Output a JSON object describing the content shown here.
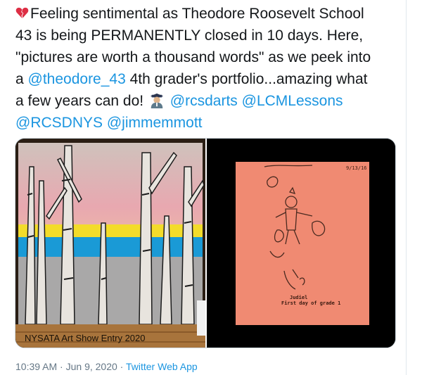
{
  "tweet": {
    "text_line1": "Feeling sentimental as Theodore Roosevelt School",
    "text_line2": "43 is being PERMANENTLY closed in 10 days. Here,",
    "text_line3": "\"pictures are worth a thousand words\" as we peek into",
    "text_line4_prefix": "a ",
    "mention_theodore": "@theodore_43",
    "text_line4_suffix": " 4th grader's portfolio...amazing what",
    "text_line5": "a few years can do!",
    "mention_rcsdarts": "@rcsdarts",
    "mention_lcmlessons": "@LCMLessons",
    "mention_rcsdnys": "@RCSDNYS",
    "mention_jimmemmott": "@jimmemmott",
    "icons": {
      "leading": "broken-heart-icon",
      "teacher": "teacher-emoji-icon"
    }
  },
  "media": {
    "left_caption": "NYSATA  Art Show Entry 2020",
    "right_paper_name": "Judiel",
    "right_paper_caption": "First day of grade 1",
    "right_paper_corner": "9/13/16"
  },
  "meta": {
    "time": "10:39 AM",
    "sep1": " · ",
    "date": "Jun 9, 2020",
    "sep2": " · ",
    "source": "Twitter Web App"
  },
  "colors": {
    "link": "#1b95e0",
    "text": "#14171a",
    "meta": "#657786"
  }
}
